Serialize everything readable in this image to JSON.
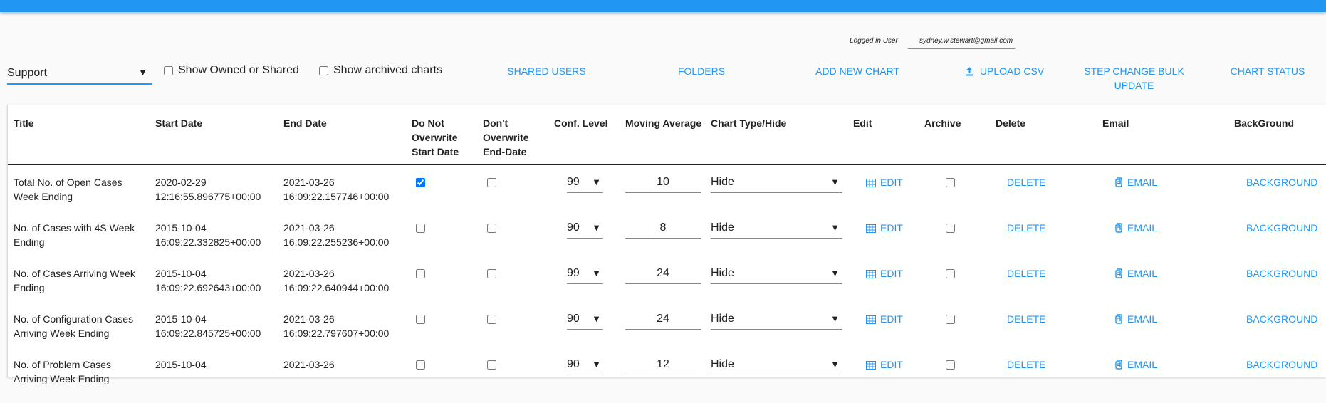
{
  "header": {
    "logged_in_label": "Logged in User",
    "user_email": "sydney.w.stewart@gmail.com",
    "accent_color": "#2196f3"
  },
  "toolbar": {
    "team_select": "Support",
    "show_owned_label": "Show Owned or Shared",
    "show_archived_label": "Show archived charts",
    "shared_users": "SHARED USERS",
    "folders": "FOLDERS",
    "add_new_chart": "ADD NEW CHART",
    "upload_csv": "UPLOAD CSV",
    "step_change_line1": "STEP CHANGE BULK",
    "step_change_line2": "UPDATE",
    "chart_status": "CHART STATUS"
  },
  "table": {
    "headers": {
      "title": "Title",
      "start_date": "Start Date",
      "end_date": "End Date",
      "dno_start_1": "Do Not",
      "dno_start_2": "Overwrite",
      "dno_start_3": "Start Date",
      "dno_end_1": "Don't",
      "dno_end_2": "Overwrite",
      "dno_end_3": "End-Date",
      "conf_level": "Conf. Level",
      "moving_average": "Moving Average",
      "chart_type": "Chart Type/Hide",
      "edit": "Edit",
      "archive": "Archive",
      "delete": "Delete",
      "email": "Email",
      "background": "BackGround"
    },
    "action_labels": {
      "edit": "EDIT",
      "delete": "DELETE",
      "email": "EMAIL",
      "background": "BACKGROUND"
    },
    "rows": [
      {
        "title_1": "Total No. of Open  Cases",
        "title_2": "Week Ending",
        "start_1": "2020-02-29",
        "start_2": "12:16:55.896775+00:00",
        "end_1": "2021-03-26",
        "end_2": "16:09:22.157746+00:00",
        "no_overwrite_start": true,
        "no_overwrite_end": false,
        "conf_level": "99",
        "moving_average": "10",
        "chart_type": "Hide",
        "archived": false
      },
      {
        "title_1": "No. of Cases with 4S Week",
        "title_2": "Ending",
        "start_1": "2015-10-04",
        "start_2": "16:09:22.332825+00:00",
        "end_1": "2021-03-26",
        "end_2": "16:09:22.255236+00:00",
        "no_overwrite_start": false,
        "no_overwrite_end": false,
        "conf_level": "90",
        "moving_average": "8",
        "chart_type": "Hide",
        "archived": false
      },
      {
        "title_1": "No. of Cases Arriving Week",
        "title_2": "Ending",
        "start_1": "2015-10-04",
        "start_2": "16:09:22.692643+00:00",
        "end_1": "2021-03-26",
        "end_2": "16:09:22.640944+00:00",
        "no_overwrite_start": false,
        "no_overwrite_end": false,
        "conf_level": "99",
        "moving_average": "24",
        "chart_type": "Hide",
        "archived": false
      },
      {
        "title_1": "No. of Configuration Cases",
        "title_2": "Arriving Week Ending",
        "start_1": "2015-10-04",
        "start_2": "16:09:22.845725+00:00",
        "end_1": "2021-03-26",
        "end_2": "16:09:22.797607+00:00",
        "no_overwrite_start": false,
        "no_overwrite_end": false,
        "conf_level": "90",
        "moving_average": "24",
        "chart_type": "Hide",
        "archived": false
      },
      {
        "title_1": "No. of Problem Cases",
        "title_2": "Arriving Week Ending",
        "start_1": "2015-10-04",
        "start_2": "",
        "end_1": "2021-03-26",
        "end_2": "",
        "no_overwrite_start": false,
        "no_overwrite_end": false,
        "conf_level": "90",
        "moving_average": "12",
        "chart_type": "Hide",
        "archived": false
      }
    ]
  }
}
